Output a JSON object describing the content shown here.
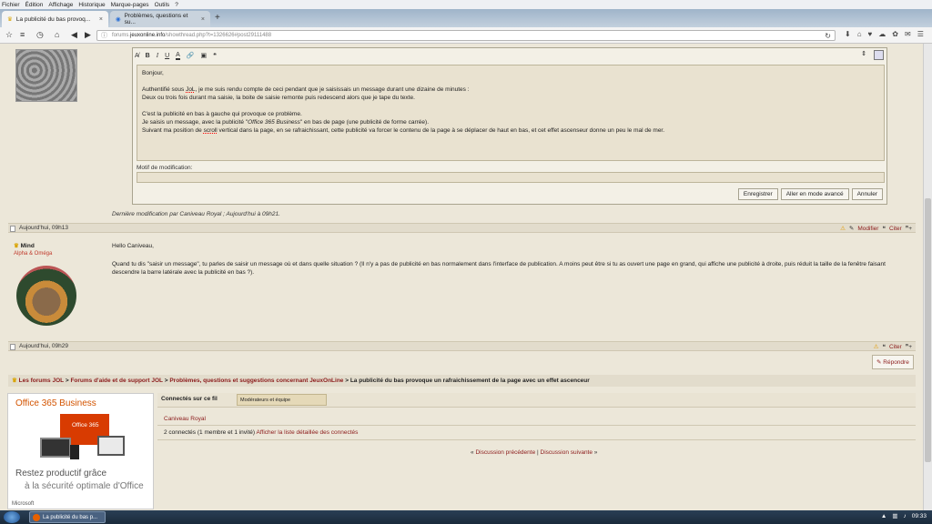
{
  "menu": [
    "Fichier",
    "Édition",
    "Affichage",
    "Historique",
    "Marque-pages",
    "Outils",
    "?"
  ],
  "tabs": [
    {
      "label": "La publicité du bas provoq...",
      "close": "×"
    },
    {
      "label": "Problèmes, questions et su...",
      "close": "×"
    }
  ],
  "newtab": "+",
  "url": {
    "prefix": "forums.",
    "host": "jeuxonline.info",
    "path": "/showthread.php?t=1326626#post29111488"
  },
  "editor": {
    "lines": [
      "Bonjour,",
      "",
      "Authentifié sous JoL, je me suis rendu compte de ceci pendant que je saisissais un message durant une dizaine de minutes :",
      "Deux ou trois fois durant ma saisie, la boite de saisie remonte puis redescend alors que je tape du texte.",
      "",
      "C'est la publicité en bas à gauche qui provoque ce problème.",
      "Je saisis un message, avec la publicité \"Office 365 Business\" en bas de page (une publicité de forme carrée).",
      "Suivant ma position de scroll vertical dans la page, en se rafraichissant, cette publicité va forcer le contenu de la page à se déplacer de haut en bas, et cet effet ascenseur donne un peu le mal de mer."
    ],
    "motif_label": "Motif de modification:",
    "buttons": {
      "save": "Enregistrer",
      "advanced": "Aller en mode avancé",
      "cancel": "Annuler"
    }
  },
  "last_edit": "Dernière modification par Caniveau Royal ; Aujourd'hui à 09h21.",
  "post1_date": "Aujourd'hui, 09h13",
  "post2_date": "Aujourd'hui, 09h29",
  "actions": {
    "modify": "Modifier",
    "quote": "Citer",
    "reply": "Répondre"
  },
  "post2": {
    "user": "Mind",
    "rank": "Alpha & Oméga",
    "greeting": "Hello Caniveau,",
    "body": "Quand tu dis \"saisir un message\", tu parles de saisir un message où et dans quelle situation ? (Il n'y a pas de publicité en bas normalement dans l'interface de publication. A moins peut être si tu as ouvert une page en grand, qui affiche une publicité à droite, puis réduit la taille de la fenêtre faisant descendre la barre latérale avec la publicité en bas ?)."
  },
  "breadcrumb": {
    "items": [
      "Les forums JOL",
      "Forums d'aide et de support JOL",
      "Problèmes, questions et suggestions concernant JeuxOnLine"
    ],
    "current": "La publicité du bas provoque un rafraichissement de la page avec un effet ascenceur"
  },
  "ad": {
    "title": "Office 365 Business",
    "box": "Office 365",
    "line1": "Restez productif grâce",
    "line2": "à la sécurité optimale d'Office",
    "brand": "Microsoft"
  },
  "connected": {
    "title": "Connectés sur ce fil",
    "moderators": "Modérateurs et équipe",
    "user": "Caniveau Royal",
    "summary": "2 connectés (1 membre et 1 invité)",
    "link": "Afficher la liste détaillée des connectés"
  },
  "discussion_nav": {
    "prev": "Discussion précédente",
    "next": "Discussion suivante"
  },
  "taskbar": {
    "item": "La publicité du bas p...",
    "clock": "09:33"
  }
}
